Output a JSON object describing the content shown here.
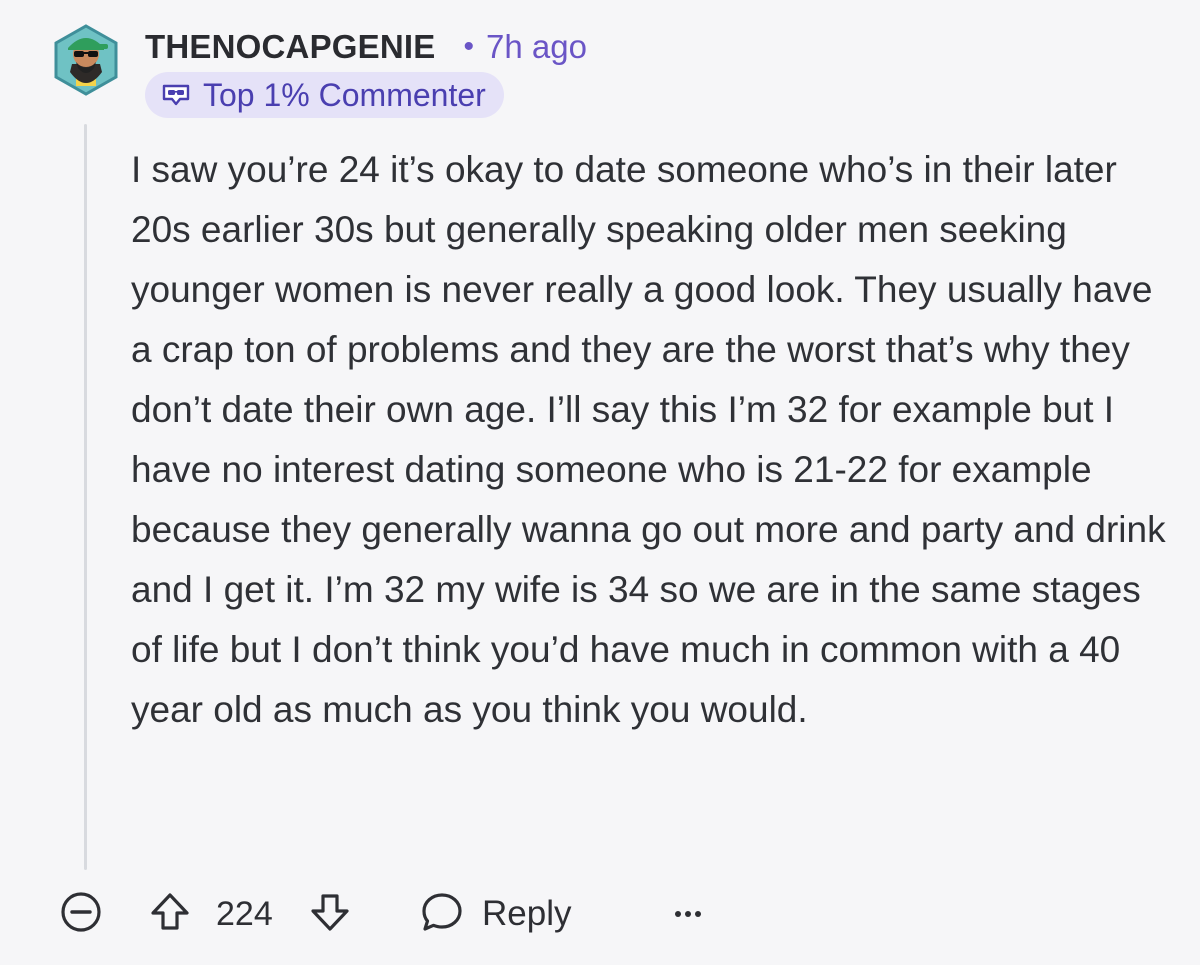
{
  "comment": {
    "username": "THENOCAPGENIE",
    "separator": "•",
    "time": "7h ago",
    "badge": {
      "icon": "top-commenter-badge-icon",
      "label": "Top 1% Commenter"
    },
    "body": "I saw you’re 24 it’s okay to date someone who’s in their later 20s earlier 30s but generally speaking older men seeking younger women is never really a good look. They usually have a crap ton of problems and they are the worst that’s why they don’t date their own age. I’ll say this I’m 32 for example but I have no interest dating someone who is 21-22 for example because they generally wanna go out more and party and drink and I get it. I’m 32 my wife is 34 so we are in the same stages of life but I don’t think you’d have much in common with a 40 year old as much as you think you would."
  },
  "actions": {
    "collapse_icon": "collapse-icon",
    "upvote_icon": "upvote-icon",
    "score": "224",
    "downvote_icon": "downvote-icon",
    "reply_icon": "reply-icon",
    "reply_label": "Reply",
    "more_label": "···"
  },
  "colors": {
    "background": "#f6f6f8",
    "accent": "#6a55c6",
    "badge_bg": "#e5e2f8",
    "badge_text": "#4a3fb0",
    "text": "#2f3136"
  }
}
